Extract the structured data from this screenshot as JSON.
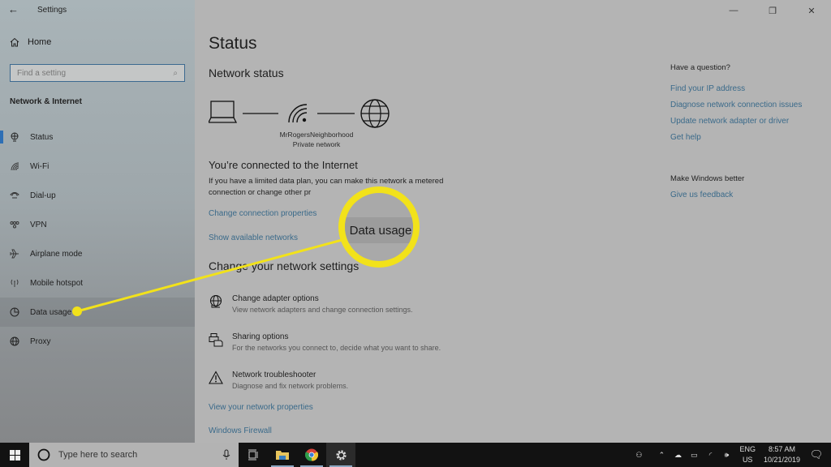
{
  "window": {
    "title": "Settings",
    "controls": {
      "minimize": "—",
      "maximize": "❐",
      "close": "✕"
    }
  },
  "sidebar": {
    "back_icon": "←",
    "home_label": "Home",
    "search_placeholder": "Find a setting",
    "section_title": "Network & Internet",
    "items": [
      {
        "label": "Status",
        "icon": "status-globe-icon",
        "active": true
      },
      {
        "label": "Wi-Fi",
        "icon": "wifi-icon"
      },
      {
        "label": "Dial-up",
        "icon": "dialup-phone-icon"
      },
      {
        "label": "VPN",
        "icon": "vpn-icon"
      },
      {
        "label": "Airplane mode",
        "icon": "airplane-icon"
      },
      {
        "label": "Mobile hotspot",
        "icon": "hotspot-icon"
      },
      {
        "label": "Data usage",
        "icon": "pie-chart-icon",
        "selected": true
      },
      {
        "label": "Proxy",
        "icon": "globe-icon"
      }
    ]
  },
  "main": {
    "title": "Status",
    "network_status_heading": "Network status",
    "network_name": "MrRogersNeighborhood",
    "network_type": "Private network",
    "connected_heading": "You’re connected to the Internet",
    "connected_desc": "If you have a limited data plan, you can make this network a metered connection or change other pr",
    "links": {
      "change_connection": "Change connection properties",
      "show_networks": "Show available networks",
      "view_properties": "View your network properties",
      "firewall": "Windows Firewall"
    },
    "change_heading": "Change your network settings",
    "options": [
      {
        "title": "Change adapter options",
        "desc": "View network adapters and change connection settings."
      },
      {
        "title": "Sharing options",
        "desc": "For the networks you connect to, decide what you want to share."
      },
      {
        "title": "Network troubleshooter",
        "desc": "Diagnose and fix network problems."
      }
    ]
  },
  "aside": {
    "question_heading": "Have a question?",
    "question_links": [
      "Find your IP address",
      "Diagnose network connection issues",
      "Update network adapter or driver",
      "Get help"
    ],
    "better_heading": "Make Windows better",
    "feedback_link": "Give us feedback"
  },
  "callout": {
    "label": "Data usage",
    "color": "#f2e21a"
  },
  "taskbar": {
    "search_placeholder": "Type here to search",
    "lang_top": "ENG",
    "lang_bottom": "US",
    "time": "8:57 AM",
    "date": "10/21/2019"
  }
}
